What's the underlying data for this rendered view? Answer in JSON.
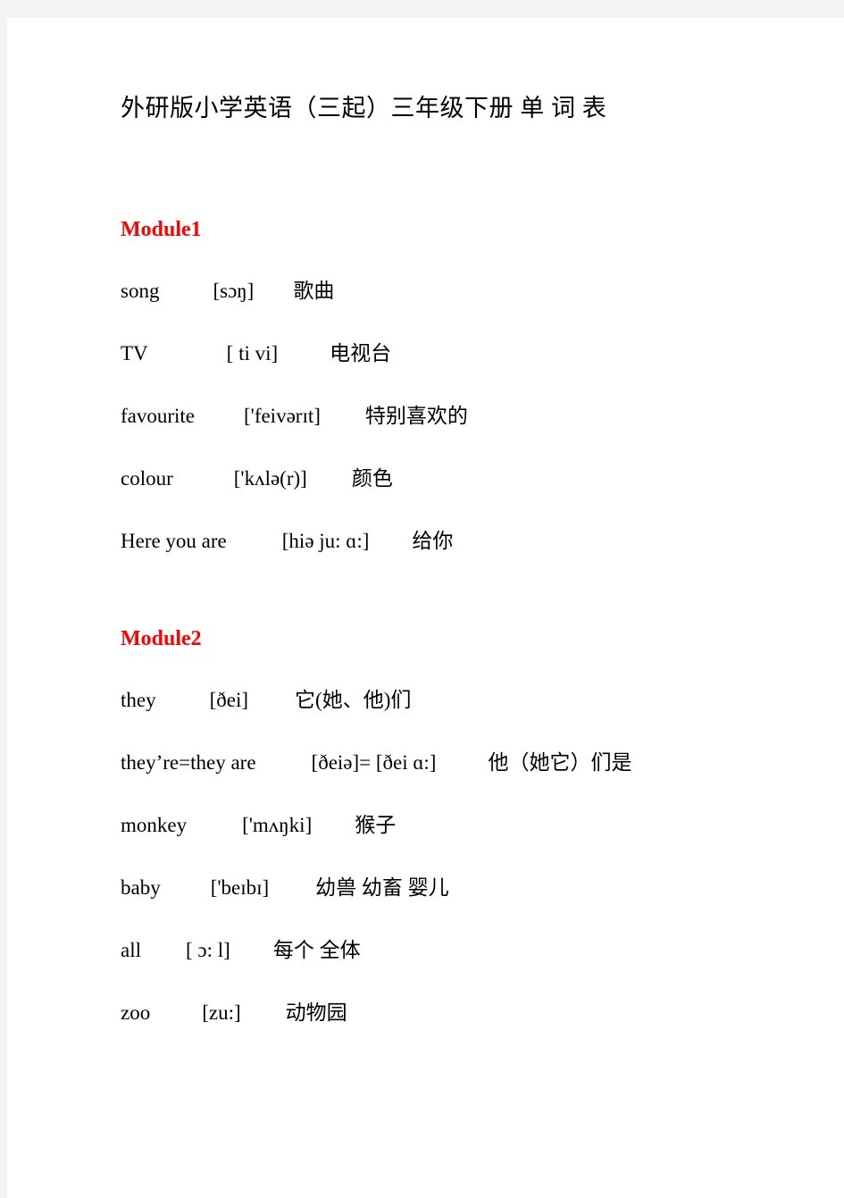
{
  "document": {
    "title": "外研版小学英语（三起）三年级下册 单 词 表"
  },
  "modules": [
    {
      "heading": "Module1",
      "words": [
        {
          "term": "song",
          "term_gap": 60,
          "phonetic": "[sɔŋ]",
          "phon_gap": 44,
          "meaning": "歌曲"
        },
        {
          "term": "TV",
          "term_gap": 88,
          "phonetic": "[ ti vi]",
          "phon_gap": 58,
          "meaning": "电视台"
        },
        {
          "term": "favourite",
          "term_gap": 55,
          "phonetic": "['feivərɪt]",
          "phon_gap": 50,
          "meaning": "特别喜欢的"
        },
        {
          "term": "colour",
          "term_gap": 68,
          "phonetic": "['kʌlə(r)]",
          "phon_gap": 50,
          "meaning": "颜色"
        },
        {
          "term": "Here you are",
          "term_gap": 62,
          "phonetic": "[hiə ju: ɑ:]",
          "phon_gap": 48,
          "meaning": "给你"
        }
      ]
    },
    {
      "heading": "Module2",
      "words": [
        {
          "term": "they",
          "term_gap": 60,
          "phonetic": "[ðei]",
          "phon_gap": 52,
          "meaning": "它(她、他)们"
        },
        {
          "term": "they’re=they are",
          "term_gap": 62,
          "phonetic": "[ðeiə]= [ðei ɑ:]",
          "phon_gap": 58,
          "meaning": "他（她它）们是"
        },
        {
          "term": "monkey",
          "term_gap": 62,
          "phonetic": "['mʌŋki]",
          "phon_gap": 48,
          "meaning": "猴子"
        },
        {
          "term": "baby",
          "term_gap": 56,
          "phonetic": "['beɪbɪ]",
          "phon_gap": 52,
          "meaning": "幼兽 幼畜 婴儿"
        },
        {
          "term": "all",
          "term_gap": 50,
          "phonetic": "[ ɔ: l]",
          "phon_gap": 48,
          "meaning": "每个 全体"
        },
        {
          "term": "zoo",
          "term_gap": 58,
          "phonetic": "[zu:]",
          "phon_gap": 50,
          "meaning": "动物园"
        }
      ]
    }
  ],
  "colors": {
    "module_heading": "#ff0000",
    "body_text": "#000000",
    "page_background": "#ffffff",
    "page_edge": "#f4f4f4"
  }
}
